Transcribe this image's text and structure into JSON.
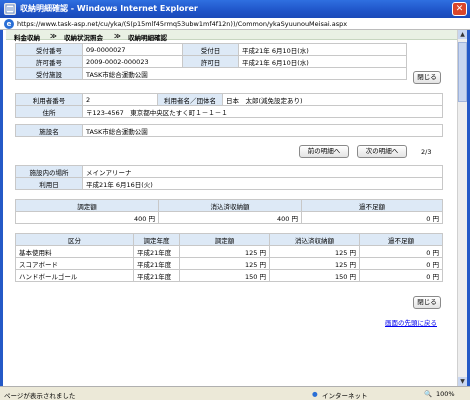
{
  "window": {
    "title": "収納明細確認 - Windows Internet Explorer",
    "close_glyph": "✕",
    "url": "https://www.task-asp.net/cu/yka/(S(p15mlf45rmq53ubw1mf4f12n))/Common/ykaSyuunouMeisai.aspx"
  },
  "breadcrumb": {
    "item1": "料金収納",
    "sep1": "≫",
    "item2": "収納状況照会",
    "sep2": "≫",
    "item3": "収納明細確認"
  },
  "permit": {
    "receipt_no_label": "受付番号",
    "receipt_no": "09-0000027",
    "receipt_date_label": "受付日",
    "receipt_date": "平成21年 6月10日(水)",
    "permit_no_label": "許可番号",
    "permit_no": "2009-0002-000023",
    "permit_date_label": "許可日",
    "permit_date": "平成21年 6月10日(水)",
    "facility_label": "受付施設",
    "facility": "TASK市総合運動公園",
    "close_button": "閉じる"
  },
  "user": {
    "user_no_label": "利用者番号",
    "user_no": "2",
    "user_name_label": "利用者名／団体名",
    "user_name": "日本　太郎(減免設定あり)",
    "address_label": "住所",
    "address": "〒123-4567　東京都中央区たすく町１－１－１"
  },
  "facility": {
    "name_label": "施設名",
    "name": "TASK市総合運動公園"
  },
  "pager": {
    "prev_button": "前の明細へ",
    "next_button": "次の明細へ",
    "position": "2/3"
  },
  "usage": {
    "place_label": "施設内の場所",
    "place": "メインアリーナ",
    "date_label": "利用日",
    "date": "平成21年 6月16日(火)"
  },
  "summary": {
    "headers": [
      "調定額",
      "消込済収納額",
      "過不足額"
    ],
    "values": [
      "400 円",
      "400 円",
      "0 円"
    ]
  },
  "details": {
    "headers": [
      "区分",
      "調定年度",
      "調定額",
      "消込済収納額",
      "過不足額"
    ],
    "rows": [
      [
        "基本使用料",
        "平成21年度",
        "125 円",
        "125 円",
        "0 円"
      ],
      [
        "スコアボード",
        "平成21年度",
        "125 円",
        "125 円",
        "0 円"
      ],
      [
        "ハンドボールゴール",
        "平成21年度",
        "150 円",
        "150 円",
        "0 円"
      ]
    ]
  },
  "footer": {
    "close_button": "閉じる",
    "back_to_top": "画面の先頭に戻る"
  },
  "status": {
    "message": "ページが表示されました",
    "zone": "インターネット",
    "zoom": "100%"
  }
}
